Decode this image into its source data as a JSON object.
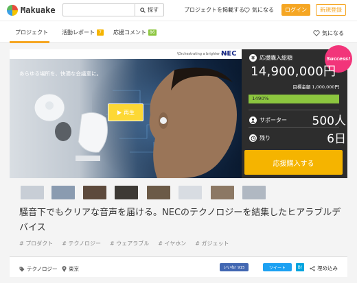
{
  "header": {
    "logo_text": "Makuake",
    "search": {
      "placeholder": "",
      "button_label": "探す"
    },
    "post_project_link": "プロジェクトを掲載する",
    "favorites_link": "気になる",
    "login_label": "ログイン",
    "signup_label": "新規登録"
  },
  "tabs": [
    {
      "label": "プロジェクト",
      "active": true
    },
    {
      "label": "活動レポート",
      "badge": "7",
      "badge_color": "#f5b400"
    },
    {
      "label": "応援コメント",
      "badge": "86",
      "badge_color": "#8cc63f"
    }
  ],
  "tab_favorite_label": "気になる",
  "hero": {
    "tagline": "\\Orchestrating a brighter world",
    "brand": "NEC",
    "caption": "あらゆる場所を、快適な会議室に。",
    "play_label": "再生"
  },
  "funding": {
    "badge": "Success!",
    "total_label": "応援購入総額",
    "amount": "14,900,000円",
    "goal": "目標金額 1,000,000円",
    "progress_text": "1490%",
    "progress_fraction": 1.0,
    "supporters_label": "サポーター",
    "supporters_value": "500人",
    "remaining_label": "残り",
    "remaining_value": "6日",
    "cta_label": "応援購入する"
  },
  "thumbnails": [
    {
      "color": "#c8ced6"
    },
    {
      "color": "#8a9bb0"
    },
    {
      "color": "#5d4a3c"
    },
    {
      "color": "#3d3a35"
    },
    {
      "color": "#6b5a47"
    },
    {
      "color": "#d8dce2"
    },
    {
      "color": "#8c7864"
    },
    {
      "color": "#b0b8c2"
    }
  ],
  "project": {
    "title": "騒音下でもクリアな音声を届ける。NECのテクノロジーを結集したヒアラブルデバイス",
    "tags": [
      "# プロダクト",
      "# テクノロジー",
      "# ウェアラブル",
      "# イヤホン",
      "# ガジェット"
    ]
  },
  "meta": {
    "category": "テクノロジー",
    "location": "東京"
  },
  "share": {
    "facebook_label": "いいね! 915",
    "twitter_label": "ツイート",
    "hatena_label": "B!",
    "embed_label": "埋め込み"
  },
  "colors": {
    "accent": "#f5a623",
    "cta": "#f5b400",
    "progress": "#8cc63f",
    "success": "#f2357a",
    "panel": "#2d2d2d"
  }
}
